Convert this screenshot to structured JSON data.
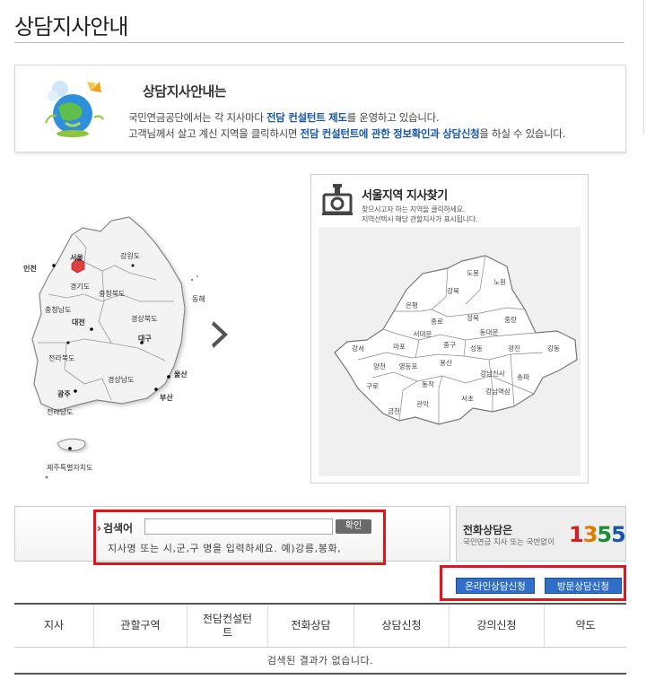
{
  "page": {
    "title": "상담지사안내"
  },
  "intro": {
    "title": "상담지사안내는",
    "line1_pre": "국민연금공단에서는 각 지사마다 ",
    "line1_hl": "전담 컨설턴트 제도",
    "line1_post": "를 운영하고 있습니다.",
    "line2_pre": "고객님께서 살고 계신 지역을 클릭하시면 ",
    "line2_hl": "전담 컨설턴트에 관한 정보확인과 상담신청",
    "line2_post": "을 하실 수 있습니다."
  },
  "korea_map": {
    "regions": [
      "인천",
      "서울",
      "경기도",
      "강원도",
      "충청북도",
      "충청남도",
      "대전",
      "경상북도",
      "대구",
      "전라북도",
      "경상남도",
      "울산",
      "부산",
      "광주",
      "전라남도",
      "동해",
      "제주특별자치도"
    ],
    "selected": "서울",
    "colors": {
      "selected": "#e04040",
      "land": "#f3f3f3",
      "border": "#888888"
    }
  },
  "seoul": {
    "title": "서울지역 지사찾기",
    "desc1": "찾으시고자 하는 지역을 클릭하세요.",
    "desc2": "지역선택시 해당 관할지사가 표시됩니다.",
    "districts": [
      "도봉",
      "노원",
      "강북",
      "은평",
      "성북",
      "중랑",
      "종로",
      "동대문",
      "서대문",
      "강서",
      "마포",
      "중구",
      "성동",
      "광진",
      "강동",
      "양천",
      "영등포",
      "용산",
      "강남신사",
      "송파",
      "구로",
      "동작",
      "강남역삼",
      "금천",
      "관악",
      "서초"
    ]
  },
  "search": {
    "label": "검색어",
    "value": "",
    "button": "확인",
    "hint": "지사명 또는 시,군,구 명을 입력하세요. 예)강릉,봉화,"
  },
  "phone": {
    "title": "전화상담은",
    "sub": "국민연금 지사 또는 국번없이",
    "digits": [
      "1",
      "3",
      "5",
      "5"
    ],
    "colors": [
      "#d32020",
      "#e07b00",
      "#1a8c3a",
      "#1a56a8"
    ]
  },
  "actions": {
    "online": "온라인상담신청",
    "visit": "방문상담신청"
  },
  "table": {
    "headers": [
      "지사",
      "관할구역",
      "전담컨설턴트",
      "전화상담",
      "상담신청",
      "강의신청",
      "약도"
    ],
    "empty": "검색된 결과가 없습니다."
  }
}
